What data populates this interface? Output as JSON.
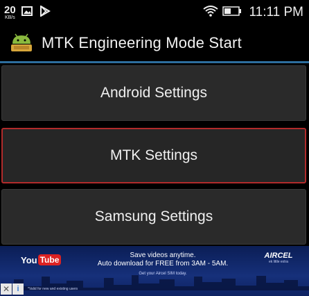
{
  "status_bar": {
    "speed_value": "20",
    "speed_unit": "KB/s",
    "time": "11:11 PM",
    "icons": [
      "image-icon",
      "play-store-icon",
      "wifi-icon",
      "battery-icon"
    ]
  },
  "app": {
    "title": "MTK Engineering Mode Start",
    "icon": "android-icon",
    "accent_color": "#2d6e9e"
  },
  "menu": {
    "items": [
      {
        "label": "Android Settings",
        "selected": false
      },
      {
        "label": "MTK Settings",
        "selected": true
      },
      {
        "label": "Samsung Settings",
        "selected": false
      }
    ],
    "selected_border_color": "#b22b2b"
  },
  "ad": {
    "brand_left_a": "You",
    "brand_left_b": "Tube",
    "line1": "Save videos anytime.",
    "line2": "Auto download for FREE from 3AM - 5AM.",
    "line3": "Get your Aircel SIM today.",
    "brand_right": "AIRCEL",
    "brand_right_tag": "ek little extra",
    "fine_print": "*Valid for new and existing users",
    "close_symbol": "✕",
    "info_symbol": "i"
  }
}
